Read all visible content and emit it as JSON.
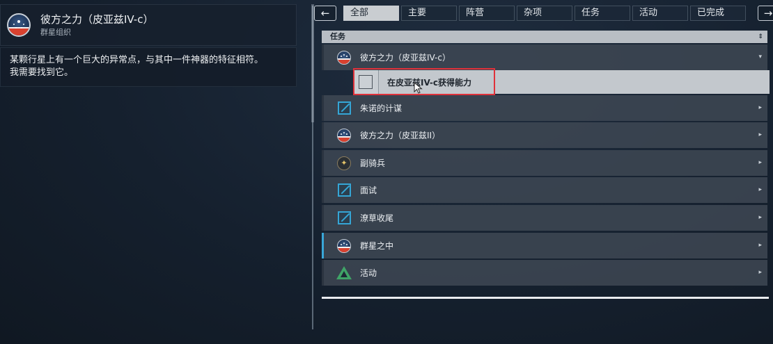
{
  "quest": {
    "title": "彼方之力（皮亚兹IV-c）",
    "faction": "群星组织",
    "description_lines": [
      "某颗行星上有一个巨大的异常点，与其中一件神器的特征相符。",
      "我需要找到它。"
    ]
  },
  "nav": {
    "back_icon": "←",
    "forward_icon": "→"
  },
  "tabs": [
    {
      "label": "全部",
      "active": true
    },
    {
      "label": "主要",
      "active": false
    },
    {
      "label": "阵营",
      "active": false
    },
    {
      "label": "杂项",
      "active": false
    },
    {
      "label": "任务",
      "active": false
    },
    {
      "label": "活动",
      "active": false
    },
    {
      "label": "已完成",
      "active": false
    }
  ],
  "list": {
    "header": "任务",
    "sort_icon": "⇕",
    "expanded_icon": "▾",
    "collapsed_icon": "▸",
    "rows": [
      {
        "label": "彼方之力（皮亚兹IV-c）",
        "icon": "constellation-emblem-icon"
      },
      {
        "label": "朱诺的计谋",
        "icon": "mission-icon"
      },
      {
        "label": "彼方之力（皮亚兹II）",
        "icon": "constellation-emblem-icon"
      },
      {
        "label": "副骑兵",
        "icon": "pilot-wings-icon"
      },
      {
        "label": "面试",
        "icon": "mission-icon"
      },
      {
        "label": "潦草收尾",
        "icon": "mission-icon"
      },
      {
        "label": "群星之中",
        "icon": "constellation-emblem-icon"
      },
      {
        "label": "活动",
        "icon": "activity-triangle-icon"
      }
    ],
    "objective": {
      "label": "在皮亚兹IV-c获得能力",
      "checked": false
    }
  },
  "colors": {
    "accent_blue": "#35a6d6",
    "highlight_red": "#e0313a",
    "activity_green": "#3fa467"
  }
}
